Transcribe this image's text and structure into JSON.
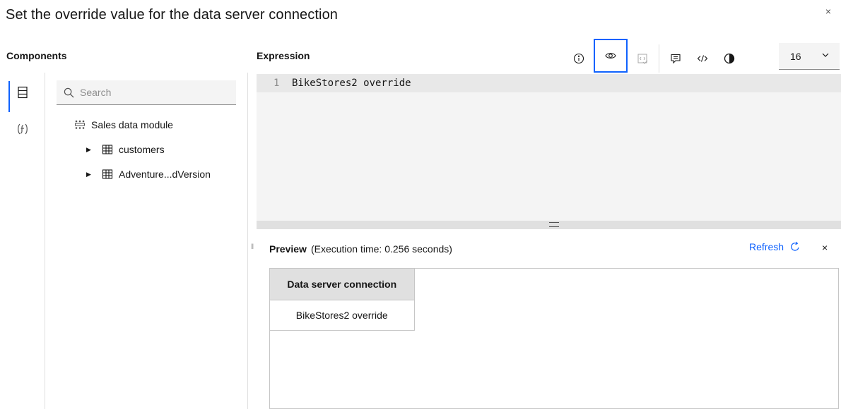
{
  "dialog": {
    "title": "Set the override value for the data server connection",
    "close": "×"
  },
  "components": {
    "heading": "Components",
    "search_placeholder": "Search",
    "tree": [
      {
        "label": "Sales data module",
        "icon": "data-module-icon"
      },
      {
        "label": "customers",
        "icon": "table-icon"
      },
      {
        "label": "Adventure...dVersion",
        "icon": "table-icon"
      }
    ]
  },
  "expression": {
    "heading": "Expression",
    "font_size": "16",
    "lines": [
      {
        "num": "1",
        "code": "BikeStores2 override"
      }
    ]
  },
  "preview": {
    "label": "Preview",
    "execution_time": "(Execution time: 0.256 seconds)",
    "refresh_label": "Refresh",
    "close": "×",
    "columns": [
      "Data server connection"
    ],
    "rows": [
      [
        "BikeStores2 override"
      ]
    ]
  },
  "colors": {
    "accent": "#0f62fe",
    "field_bg": "#f4f4f4",
    "border": "#e0e0e0"
  }
}
